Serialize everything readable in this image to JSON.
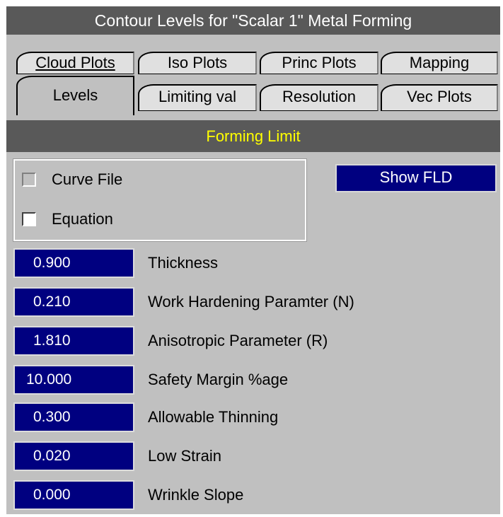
{
  "window": {
    "title": "Contour Levels for \"Scalar 1\" Metal Forming"
  },
  "tabs": {
    "back_row": [
      {
        "label": "Cloud Plots"
      },
      {
        "label": "Iso Plots"
      },
      {
        "label": "Princ Plots"
      },
      {
        "label": "Mapping"
      }
    ],
    "front_row": [
      {
        "label": "Levels",
        "active": true
      },
      {
        "label": "Limiting val"
      },
      {
        "label": "Resolution"
      },
      {
        "label": "Vec Plots"
      }
    ]
  },
  "section": {
    "title": "Forming Limit"
  },
  "options": {
    "curve_file": {
      "label": "Curve File",
      "checked": false
    },
    "equation": {
      "label": "Equation",
      "checked": true
    }
  },
  "show_fld": {
    "label": "Show FLD"
  },
  "params": [
    {
      "value": "0.900",
      "label": "Thickness"
    },
    {
      "value": "0.210",
      "label": "Work Hardening Paramter (N)"
    },
    {
      "value": "1.810",
      "label": "Anisotropic Parameter (R)"
    },
    {
      "value": "10.000",
      "label": "Safety Margin %age"
    },
    {
      "value": "0.300",
      "label": "Allowable Thinning"
    },
    {
      "value": "0.020",
      "label": "Low Strain"
    },
    {
      "value": "0.000",
      "label": "Wrinkle Slope"
    }
  ],
  "colors": {
    "title_bar": "#595959",
    "panel": "#c0c0c0",
    "input_bg": "#000080",
    "section_text": "#ffff00"
  }
}
